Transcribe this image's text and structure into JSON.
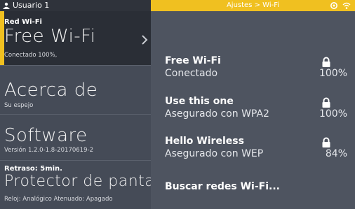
{
  "sidebar": {
    "user": {
      "name": "Usuario 1",
      "icon": "user-icon"
    },
    "items": [
      {
        "top_label": "Red Wi-Fi",
        "title": "Free Wi-Fi",
        "subtitle": "Conectado 100%,",
        "active": true,
        "icon": "chevron-right-icon"
      },
      {
        "title": "Acerca de",
        "subtitle": "Su espejo"
      },
      {
        "title": "Software",
        "subtitle": "Versión 1.2.0-1.8-20170619-2"
      },
      {
        "top_label": "Retraso: 5min.",
        "title": "Protector de pantalla",
        "subtitle": "Reloj: Analógico   Atenuado: Apagado"
      }
    ]
  },
  "header": {
    "breadcrumb": "Ajustes > Wi-Fi",
    "icons": [
      "settings-icon",
      "wifi-icon"
    ],
    "accent": "#f0c020"
  },
  "networks": [
    {
      "name": "Free Wi-Fi",
      "status": "Conectado",
      "signal": "100%",
      "icon": "lock-icon"
    },
    {
      "name": "Use this one",
      "status": "Asegurado con WPA2",
      "signal": "100%",
      "icon": "lock-icon"
    },
    {
      "name": "Hello Wireless",
      "status": "Asegurado con WEP",
      "signal": "84%",
      "icon": "lock-icon"
    }
  ],
  "scan_label": "Buscar redes Wi-Fi..."
}
